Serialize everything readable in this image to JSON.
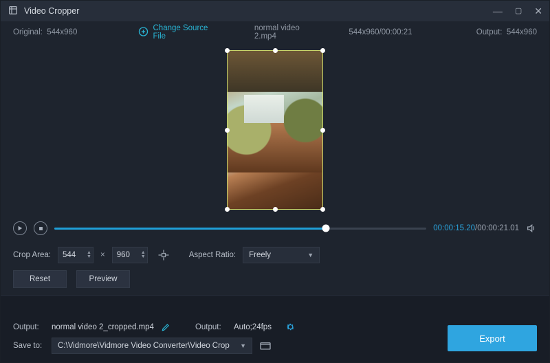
{
  "titlebar": {
    "title": "Video Cropper"
  },
  "infobar": {
    "original_label": "Original:",
    "original_dims": "544x960",
    "change_source": "Change Source File",
    "filename": "normal video 2.mp4",
    "source_meta": "544x960/00:00:21",
    "output_label": "Output:",
    "output_dims": "544x960"
  },
  "playback": {
    "current_time": "00:00:15.20",
    "total_time": "00:00:21.01"
  },
  "crop": {
    "label": "Crop Area:",
    "width": "544",
    "height": "960",
    "aspect_label": "Aspect Ratio:",
    "aspect_value": "Freely"
  },
  "actions": {
    "reset": "Reset",
    "preview": "Preview"
  },
  "output": {
    "label1": "Output:",
    "filename": "normal video 2_cropped.mp4",
    "label2": "Output:",
    "format": "Auto;24fps",
    "save_label": "Save to:",
    "save_path": "C:\\Vidmore\\Vidmore Video Converter\\Video Crop",
    "export": "Export"
  }
}
